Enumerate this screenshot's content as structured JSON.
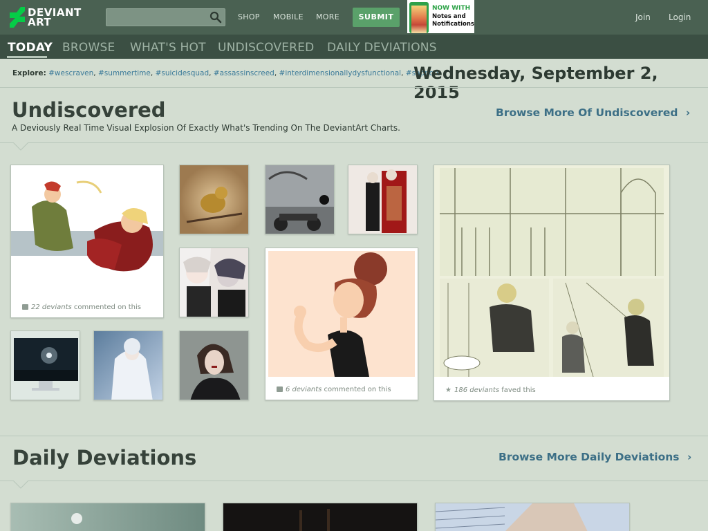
{
  "header": {
    "logo_line1": "DEVIANT",
    "logo_line2": "ART",
    "search_placeholder": "",
    "nav": [
      "SHOP",
      "MOBILE",
      "MORE"
    ],
    "submit_label": "SUBMIT",
    "promo_title": "NOW WITH",
    "promo_line1": "Notes and",
    "promo_line2": "Notifications",
    "join_label": "Join",
    "login_label": "Login"
  },
  "subnav": {
    "tabs": [
      "TODAY",
      "BROWSE",
      "WHAT'S HOT",
      "UNDISCOVERED",
      "DAILY DEVIATIONS"
    ]
  },
  "explore": {
    "label": "Explore:",
    "tags": [
      "#wescraven",
      "#summertime",
      "#suicidesquad",
      "#assassinscreed",
      "#interdimensionallydysfunctional",
      "#sapporo"
    ]
  },
  "date": "Wednesday, September 2, 2015",
  "undiscovered": {
    "title": "Undiscovered",
    "description": "A Deviously Real Time Visual Explosion Of Exactly What's Trending On The DeviantArt Charts.",
    "browse_more": "Browse More Of Undiscovered",
    "cards": [
      {
        "count": "22 deviants",
        "suffix": "commented on this"
      },
      {
        "count": "6 deviants",
        "suffix": "commented on this"
      },
      {
        "count": "186 deviants",
        "suffix": "faved this"
      }
    ]
  },
  "daily": {
    "title": "Daily Deviations",
    "browse_more": "Browse More Daily Deviations"
  },
  "colors": {
    "topbar": "#4a6152",
    "subnav": "#3b4f43",
    "page_bg": "#d3ddd1",
    "submit": "#5aa16a",
    "link": "#3c6f86",
    "tag": "#3b7a99"
  }
}
